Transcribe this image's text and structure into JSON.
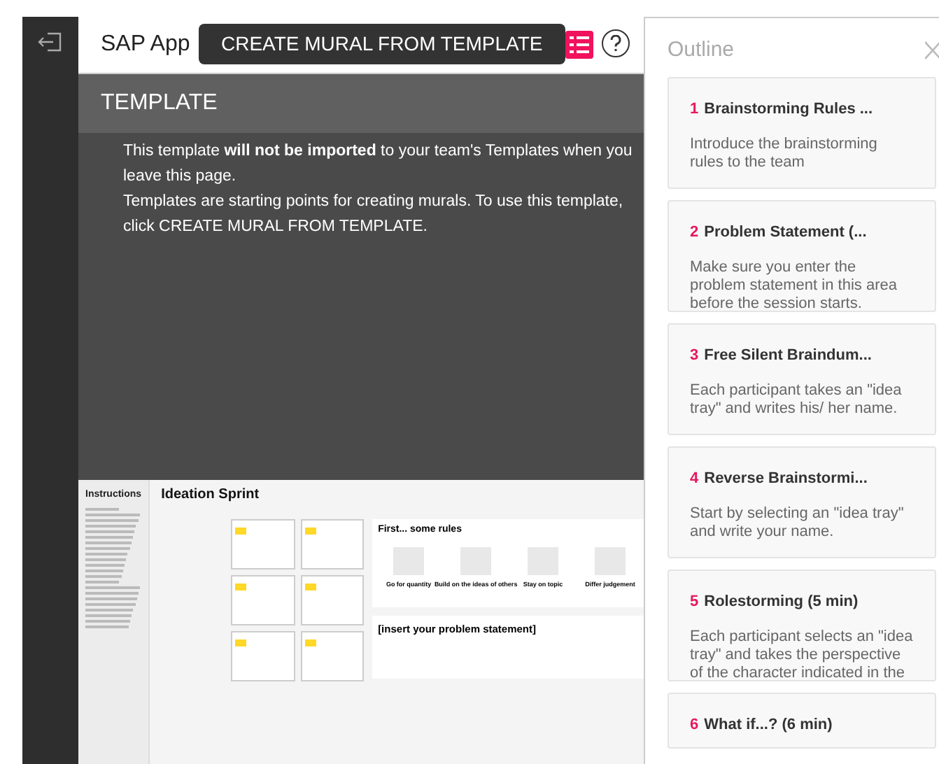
{
  "header": {
    "title": "SAP App",
    "create_button": "CREATE MURAL FROM TEMPLATE",
    "outline_toggle_on": true
  },
  "template_banner": {
    "heading": "TEMPLATE",
    "lines": [
      "This template **will not be imported** to your team's Templates when you leave this page.",
      "Templates are starting points for creating murals. To use this template, click CREATE MURAL FROM TEMPLATE."
    ]
  },
  "preview": {
    "sidebar_heading": "Instructions",
    "title": "Ideation Sprint",
    "rules_heading": "First... some rules",
    "rules": [
      "Go for quantity",
      "Build on the ideas of others",
      "Stay on topic",
      "Differ judgement"
    ],
    "problem_heading": "[insert your problem statement]"
  },
  "outline": {
    "title": "Outline",
    "items": [
      {
        "number": "1",
        "title": "Brainstorming Rules ...",
        "description": "Introduce the brainstorming rules to the team"
      },
      {
        "number": "2",
        "title": "Problem Statement (...",
        "description": "Make sure you enter the problem statement in this area before the session starts."
      },
      {
        "number": "3",
        "title": "Free Silent Braindum...",
        "description": "Each participant takes an \"idea tray\" and writes his/ her name."
      },
      {
        "number": "4",
        "title": "Reverse Brainstormi...",
        "description": "Start by selecting an \"idea tray\" and write your name."
      },
      {
        "number": "5",
        "title": "Rolestorming (5 min)",
        "description": "Each participant selects an \"idea tray\" and takes the perspective of the character indicated in the"
      },
      {
        "number": "6",
        "title": "What if...? (6 min)"
      }
    ]
  }
}
